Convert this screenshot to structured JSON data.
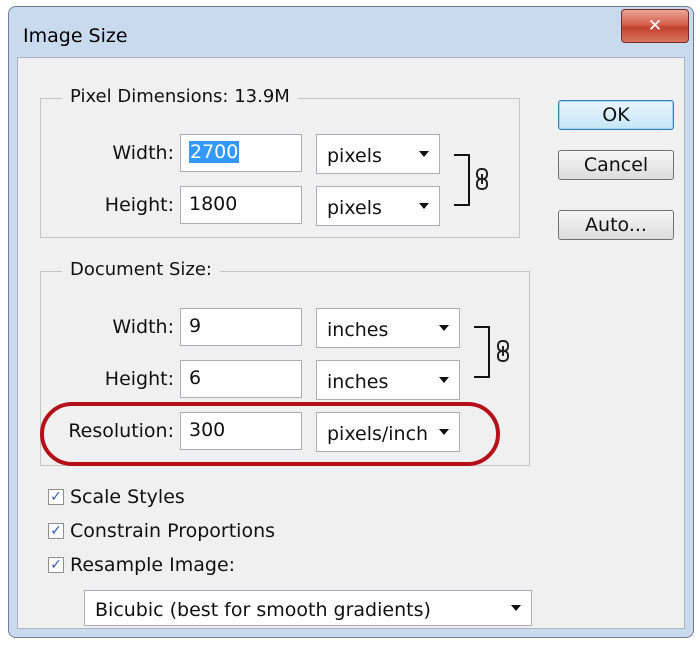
{
  "window": {
    "title": "Image Size",
    "close_glyph": "✕"
  },
  "pixel_dimensions": {
    "legend": "Pixel Dimensions:  13.9M",
    "width_label": "Width:",
    "width_value_selected": "2700",
    "width_unit": "pixels",
    "height_label": "Height:",
    "height_value": "1800",
    "height_unit": "pixels",
    "link_icon": "chain-link-icon"
  },
  "document_size": {
    "legend": "Document Size:",
    "width_label": "Width:",
    "width_value": "9",
    "width_unit": "inches",
    "height_label": "Height:",
    "height_value": "6",
    "height_unit": "inches",
    "resolution_label": "Resolution:",
    "resolution_value": "300",
    "resolution_unit": "pixels/inch",
    "link_icon": "chain-link-icon"
  },
  "buttons": {
    "ok": "OK",
    "cancel": "Cancel",
    "auto": "Auto..."
  },
  "options": {
    "scale_styles": {
      "label": "Scale Styles",
      "checked": true
    },
    "constrain_proportions": {
      "label": "Constrain Proportions",
      "checked": true
    },
    "resample_image": {
      "label": "Resample Image:",
      "checked": true
    },
    "resample_method": "Bicubic (best for smooth gradients)"
  },
  "colors": {
    "highlight": "#b4101a",
    "selection": "#3399ff",
    "default_button_border": "#3c7fb1"
  }
}
